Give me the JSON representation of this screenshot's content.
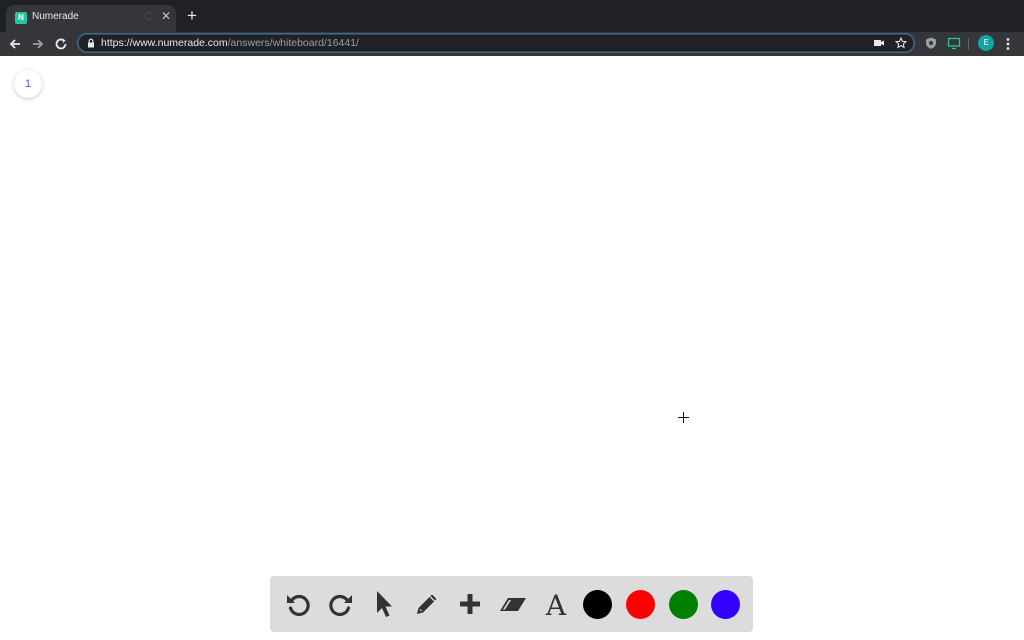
{
  "browser": {
    "tab": {
      "title": "Numerade",
      "favicon_letter": "N"
    },
    "omnibox": {
      "url_host": "https://www.numerade.com",
      "url_path": "/answers/whiteboard/16441/"
    },
    "profile_initial": "E"
  },
  "whiteboard": {
    "page_number": "1",
    "colors": {
      "black": "#000000",
      "red": "#ff0000",
      "green": "#008000",
      "blue": "#3300ff"
    }
  }
}
